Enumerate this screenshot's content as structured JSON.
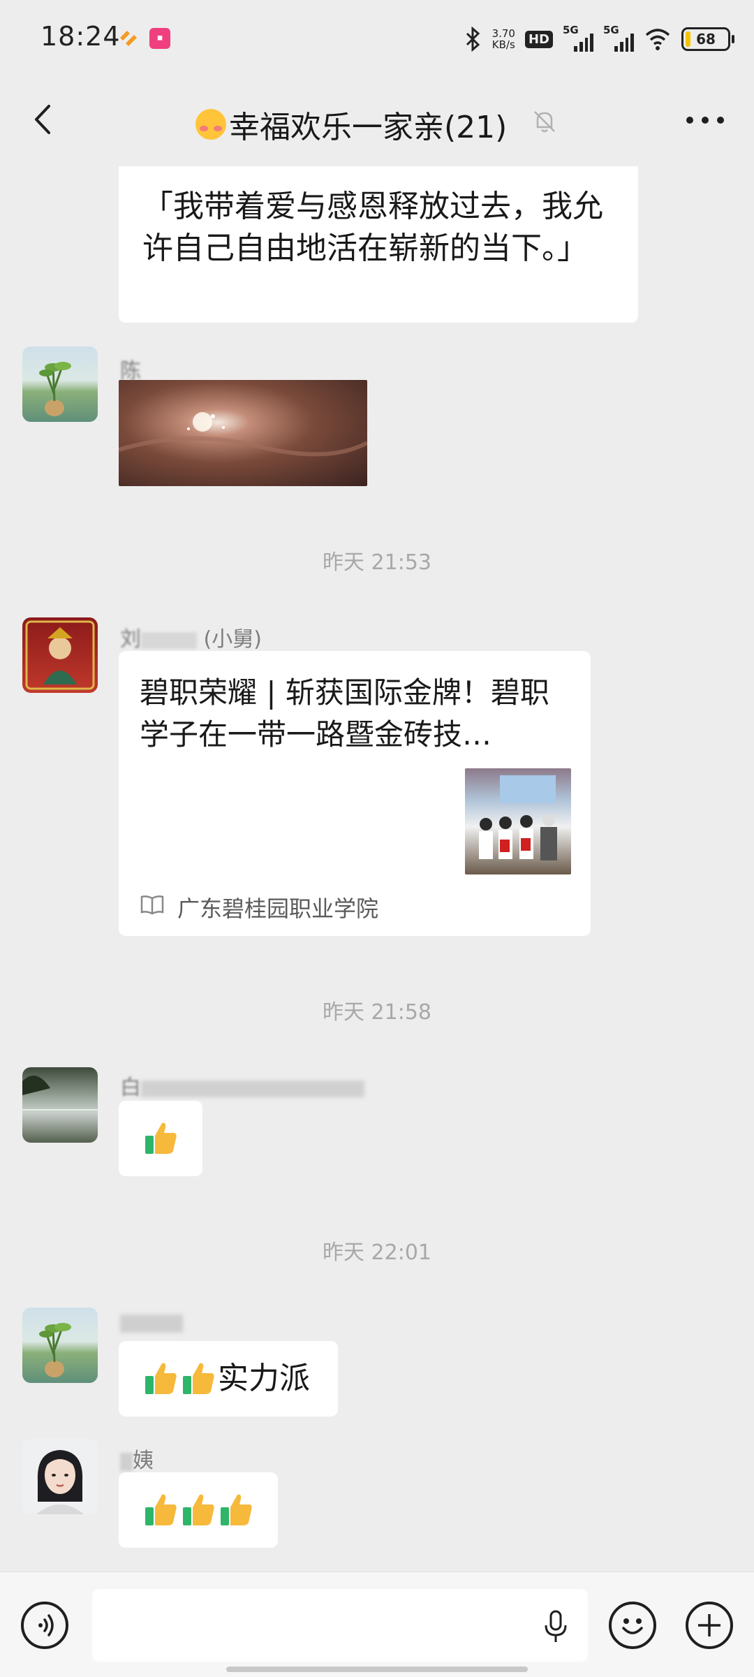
{
  "status_bar": {
    "time": "18:24",
    "net_speed_value": "3.70",
    "net_speed_unit": "KB/s",
    "hd_label": "HD",
    "signal1_label": "5G",
    "signal2_label": "5G",
    "battery": "68",
    "icons": [
      "bluetooth-icon",
      "wifi-icon",
      "battery-icon"
    ]
  },
  "header": {
    "title": "幸福欢乐一家亲(21)",
    "title_emoji": "smiling-face-with-hearts-icon",
    "muted": true
  },
  "messages": [
    {
      "type": "text",
      "text": "「我带着爱与感恩释放过去，我允许自己自由地活在崭新的当下。」"
    },
    {
      "type": "image",
      "sender": "陈"
    },
    {
      "type": "time",
      "text": "昨天 21:53"
    },
    {
      "type": "article",
      "sender": "刘",
      "sender_suffix": "(小舅)",
      "title": "碧职荣耀 | 斩获国际金牌！碧职学子在一带一路暨金砖技…",
      "source": "广东碧桂园职业学院"
    },
    {
      "type": "time",
      "text": "昨天 21:58"
    },
    {
      "type": "emoji",
      "sender": "白",
      "emoji": "thumbs-up"
    },
    {
      "type": "time",
      "text": "昨天 22:01"
    },
    {
      "type": "text",
      "sender": "",
      "text": "实力派",
      "emoji_count": 2
    },
    {
      "type": "emoji",
      "sender": "姨",
      "emoji_count": 3
    }
  ],
  "colors": {
    "background": "#ededed",
    "bubble": "#ffffff",
    "thumb_yellow": "#f6b93b",
    "thumb_green": "#2fb56a"
  }
}
